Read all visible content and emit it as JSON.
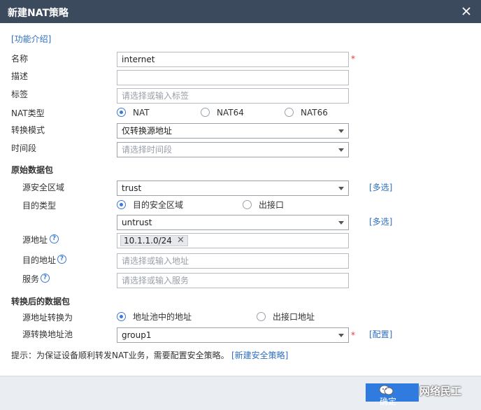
{
  "dialog": {
    "title": "新建NAT策略"
  },
  "intro_link": "[功能介绍]",
  "form": {
    "name": {
      "label": "名称",
      "value": "internet",
      "required": "*"
    },
    "desc": {
      "label": "描述",
      "value": ""
    },
    "tag": {
      "label": "标签",
      "placeholder": "请选择或输入标签"
    },
    "nat_type": {
      "label": "NAT类型",
      "options": [
        "NAT",
        "NAT64",
        "NAT66"
      ],
      "selected": "NAT"
    },
    "mode": {
      "label": "转换模式",
      "value": "仅转换源地址"
    },
    "time": {
      "label": "时间段",
      "placeholder": "请选择时间段"
    }
  },
  "original": {
    "heading": "原始数据包",
    "src_zone": {
      "label": "源安全区域",
      "value": "trust",
      "link": "[多选]"
    },
    "dst_type": {
      "label": "目的类型",
      "options": [
        "目的安全区域",
        "出接口"
      ],
      "selected": "目的安全区域"
    },
    "dst_zone": {
      "value": "untrust",
      "link": "[多选]"
    },
    "src_addr": {
      "label": "源地址",
      "tag": "10.1.1.0/24"
    },
    "dst_addr": {
      "label": "目的地址",
      "placeholder": "请选择或输入地址"
    },
    "service": {
      "label": "服务",
      "placeholder": "请选择或输入服务"
    }
  },
  "translated": {
    "heading": "转换后的数据包",
    "src_conv": {
      "label": "源地址转换为",
      "options": [
        "地址池中的地址",
        "出接口地址"
      ],
      "selected": "地址池中的地址"
    },
    "pool": {
      "label": "源转换地址池",
      "value": "group1",
      "required": "*",
      "link": "[配置]"
    }
  },
  "hint": {
    "text": "提示：为保证设备顺利转发NAT业务，需要配置安全策略。",
    "link": "[新建安全策略]"
  },
  "footer": {
    "ok_label": "确定",
    "watermark": "网络民工"
  },
  "colors": {
    "titlebar": "#3c4a5e",
    "accent": "#2f7be0",
    "link": "#2f6fbf",
    "required": "#e03c31"
  },
  "icons": {
    "close": "close-icon",
    "help": "help-icon",
    "caret": "chevron-down-icon",
    "remove": "remove-icon"
  }
}
